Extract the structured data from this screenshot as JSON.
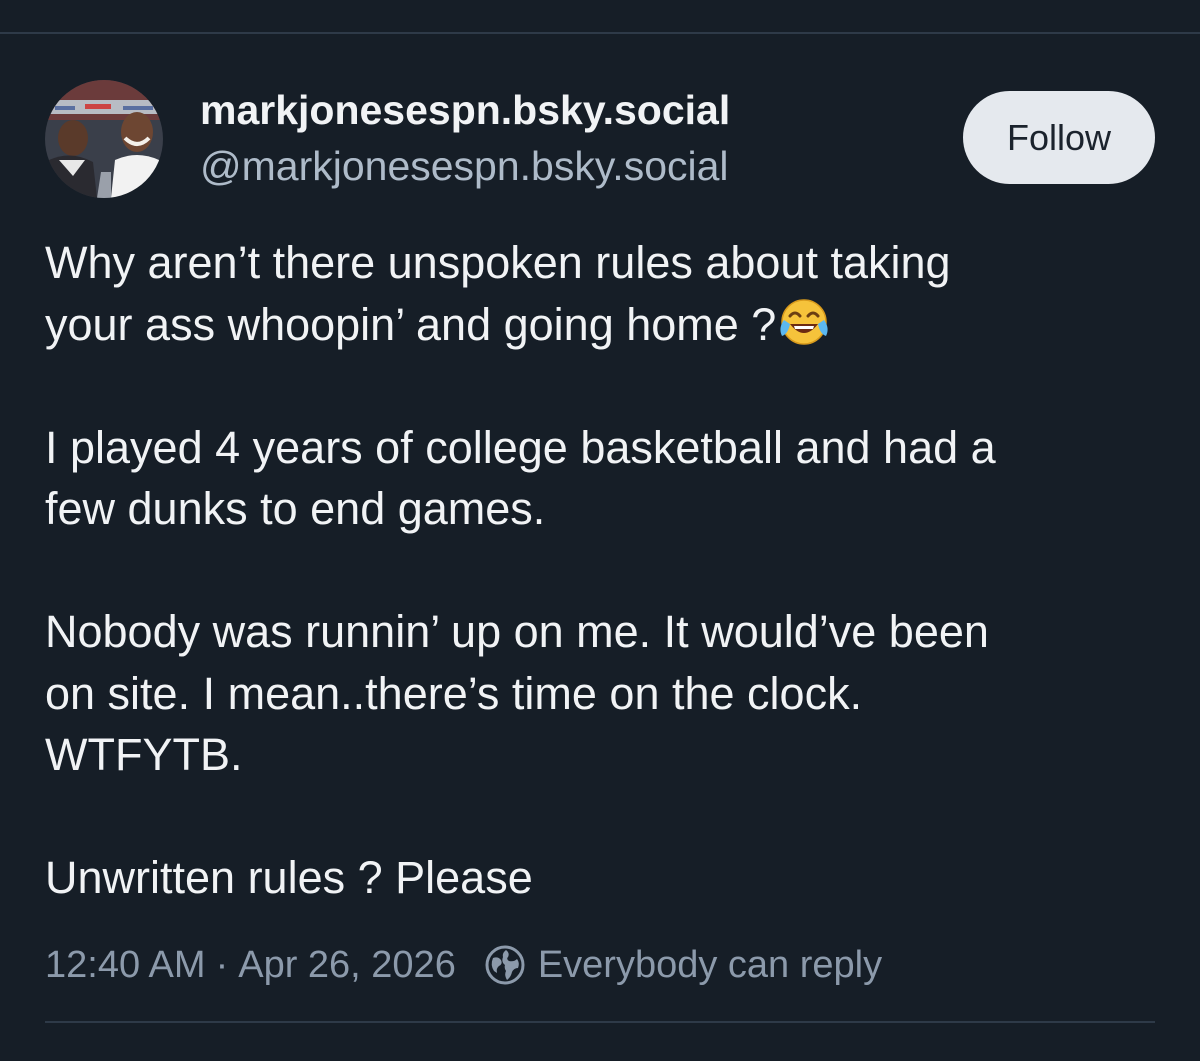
{
  "post": {
    "author": {
      "display_name": "markjonesespn.bsky.social",
      "handle": "@markjonesespn.bsky.social"
    },
    "follow_label": "Follow",
    "paragraphs": [
      {
        "lines": [
          "Why aren’t there unspoken rules about taking",
          "your ass whoopin’ and going home ?"
        ],
        "trailing_emoji": "face-with-tears-of-joy"
      },
      {
        "lines": [
          "I played 4 years of college basketball and had a",
          "few dunks to end games."
        ]
      },
      {
        "lines": [
          "Nobody was runnin’ up on me. It would’ve been",
          "on site. I mean..there’s time on the clock.",
          "WTFYTB."
        ]
      },
      {
        "lines": [
          "Unwritten rules ? Please"
        ]
      }
    ],
    "time": "12:40 AM",
    "separator": "·",
    "date": "Apr 26, 2026",
    "reply_setting": "Everybody can reply",
    "reply_icon": "globe-icon"
  },
  "colors": {
    "background": "#161e27",
    "text": "#f1f3f5",
    "secondary_text": "#aebbc9",
    "meta_text": "#8c9aab",
    "follow_button_bg": "#e5e9ee",
    "divider": "#2e3a48"
  }
}
